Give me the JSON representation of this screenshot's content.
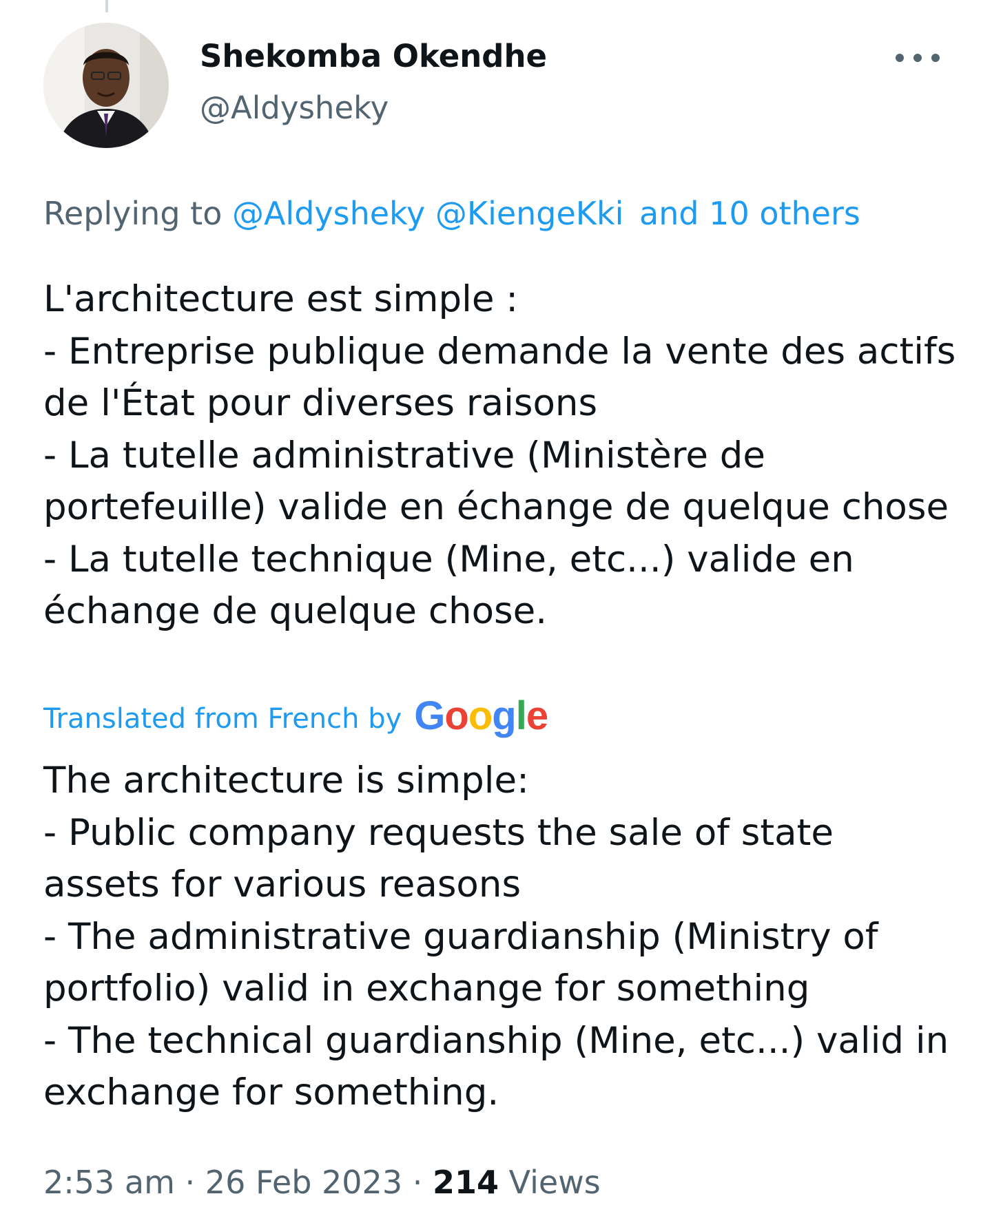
{
  "author": {
    "name": "Shekomba Okendhe",
    "handle": "@Aldysheky"
  },
  "reply": {
    "prefix": "Replying to",
    "mentions": [
      "@Aldysheky",
      "@KiengeKki"
    ],
    "others": "and 10 others"
  },
  "tweet": {
    "original_text": "L'architecture est simple :\n- Entreprise publique demande la vente des actifs de l'État pour diverses raisons\n- La tutelle administrative (Ministère de portefeuille) valide en échange de quelque chose\n- La tutelle technique (Mine, etc...) valide en échange de quelque chose.",
    "translated_by": "Translated from French by",
    "translator": "Google",
    "translated_text": "The architecture is simple:\n- Public company requests the sale of state assets for various reasons\n- The administrative guardianship (Ministry of portfolio) valid in exchange for something\n- The technical guardianship (Mine, etc...) valid in exchange for something."
  },
  "meta": {
    "time": "2:53 am",
    "date": "26 Feb 2023",
    "separator": "·",
    "views_count": "214",
    "views_label": "Views"
  },
  "colors": {
    "link": "#1d9bf0",
    "secondary_text": "#536471",
    "primary_text": "#0f1419",
    "google_blue": "#4285f4",
    "google_red": "#ea4335",
    "google_yellow": "#fbbc05",
    "google_green": "#34a853"
  },
  "icons": {
    "more": "more-horizontal-icon",
    "avatar": "profile-photo"
  }
}
